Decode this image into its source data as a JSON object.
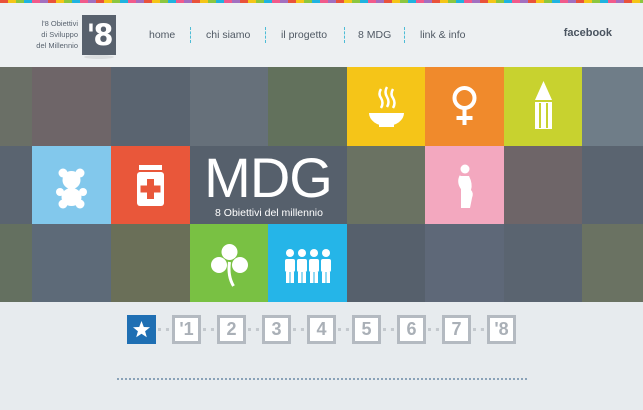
{
  "brand": {
    "lines": [
      "l'8 Obiettivi",
      "di Sviluppo",
      "del Millennio"
    ],
    "logo_text": "'8"
  },
  "nav": {
    "items": [
      "home",
      "chi siamo",
      "il progetto",
      "8 MDG",
      "link & info"
    ]
  },
  "social": {
    "facebook_label": "facebook"
  },
  "hero": {
    "title": "MDG",
    "subtitle": "8 Obiettivi del millennio"
  },
  "goal_icons": [
    "hunger-bowl-icon",
    "gender-equality-icon",
    "education-pencil-icon",
    "child-teddy-icon",
    "health-medicine-icon",
    "maternal-health-icon",
    "environment-clover-icon",
    "partnership-people-icon"
  ],
  "colors": {
    "yellow": "#f5c518",
    "orange": "#f08a2c",
    "lime": "#c8d22f",
    "light_blue": "#82c8ec",
    "red": "#e9573a",
    "pink": "#f3a8bf",
    "green": "#79c143",
    "cyan": "#25b5e8",
    "accent_blue": "#1f6fb3",
    "nav_separator": "#4cbcd6"
  },
  "pager": {
    "items": [
      "★",
      "'1",
      "2",
      "3",
      "4",
      "5",
      "6",
      "7",
      "'8"
    ],
    "active_index": 0
  }
}
